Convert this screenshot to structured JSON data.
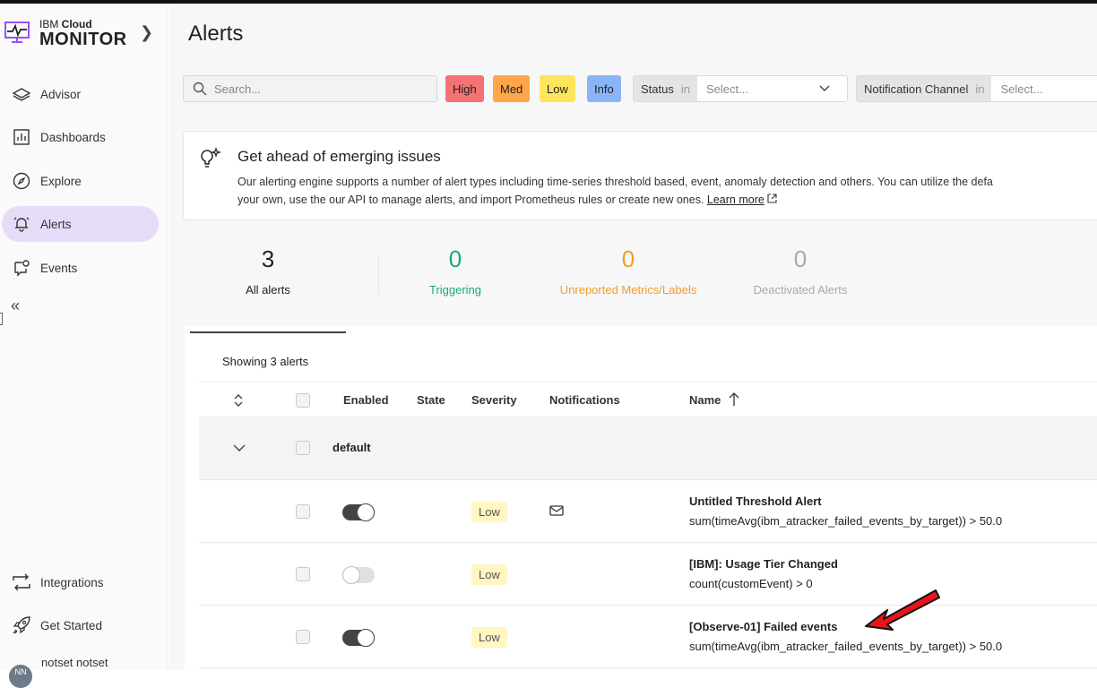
{
  "sidebar": {
    "brand_top_regular": "IBM ",
    "brand_top_bold": "Cloud",
    "brand_main": "MONITOR",
    "items": [
      {
        "label": "Advisor",
        "icon": "layers-icon"
      },
      {
        "label": "Dashboards",
        "icon": "dashboard-icon"
      },
      {
        "label": "Explore",
        "icon": "compass-icon"
      },
      {
        "label": "Alerts",
        "icon": "bell-icon",
        "active": true
      },
      {
        "label": "Events",
        "icon": "events-icon"
      },
      {
        "label": "Integrations",
        "icon": "integrations-icon"
      },
      {
        "label": "Get Started",
        "icon": "rocket-icon"
      }
    ],
    "user_name": "notset notset",
    "user_initials": "NN"
  },
  "page": {
    "title": "Alerts"
  },
  "filters": {
    "search_placeholder": "Search...",
    "severity": [
      "High",
      "Med",
      "Low",
      "Info"
    ],
    "status_label": "Status",
    "in_text": "in",
    "status_value": "Select...",
    "notif_label": "Notification Channel",
    "notif_value": "Select..."
  },
  "banner": {
    "title": "Get ahead of emerging issues",
    "line1": "Our alerting engine supports a number of alert types including time-series threshold based, event, anomaly detection and others. You can utilize the defa",
    "line2": "your own, use the our API to manage alerts, and import Prometheus rules or create new ones. ",
    "learn_more": "Learn more"
  },
  "stats": {
    "all": {
      "count": "3",
      "label": "All alerts"
    },
    "triggering": {
      "count": "0",
      "label": "Triggering"
    },
    "unreported": {
      "count": "0",
      "label": "Unreported Metrics/Labels"
    },
    "deactivated": {
      "count": "0",
      "label": "Deactivated Alerts"
    }
  },
  "table": {
    "showing_prefix": "Showing ",
    "showing_count": "3 alerts",
    "headers": {
      "enabled": "Enabled",
      "state": "State",
      "severity": "Severity",
      "notifications": "Notifications",
      "name": "Name"
    },
    "group": "default",
    "rows": [
      {
        "enabled": true,
        "severity": "Low",
        "has_notification": true,
        "name": "Untitled Threshold Alert",
        "query": "sum(timeAvg(ibm_atracker_failed_events_by_target)) > 50.0"
      },
      {
        "enabled": false,
        "severity": "Low",
        "has_notification": false,
        "name": "[IBM]: Usage Tier Changed",
        "query": "count(customEvent) > 0"
      },
      {
        "enabled": true,
        "severity": "Low",
        "has_notification": false,
        "name": "[Observe-01] Failed events",
        "query": "sum(timeAvg(ibm_atracker_failed_events_by_target)) > 50.0"
      }
    ]
  },
  "colors": {
    "accent_active": "#e7dcf7",
    "triggering": "#1aab73",
    "unreported": "#f39b2e",
    "high": "#f47174",
    "med": "#ffa54a",
    "low": "#ffe55c",
    "info": "#8ab4f8",
    "arrow": "#e8141b"
  }
}
